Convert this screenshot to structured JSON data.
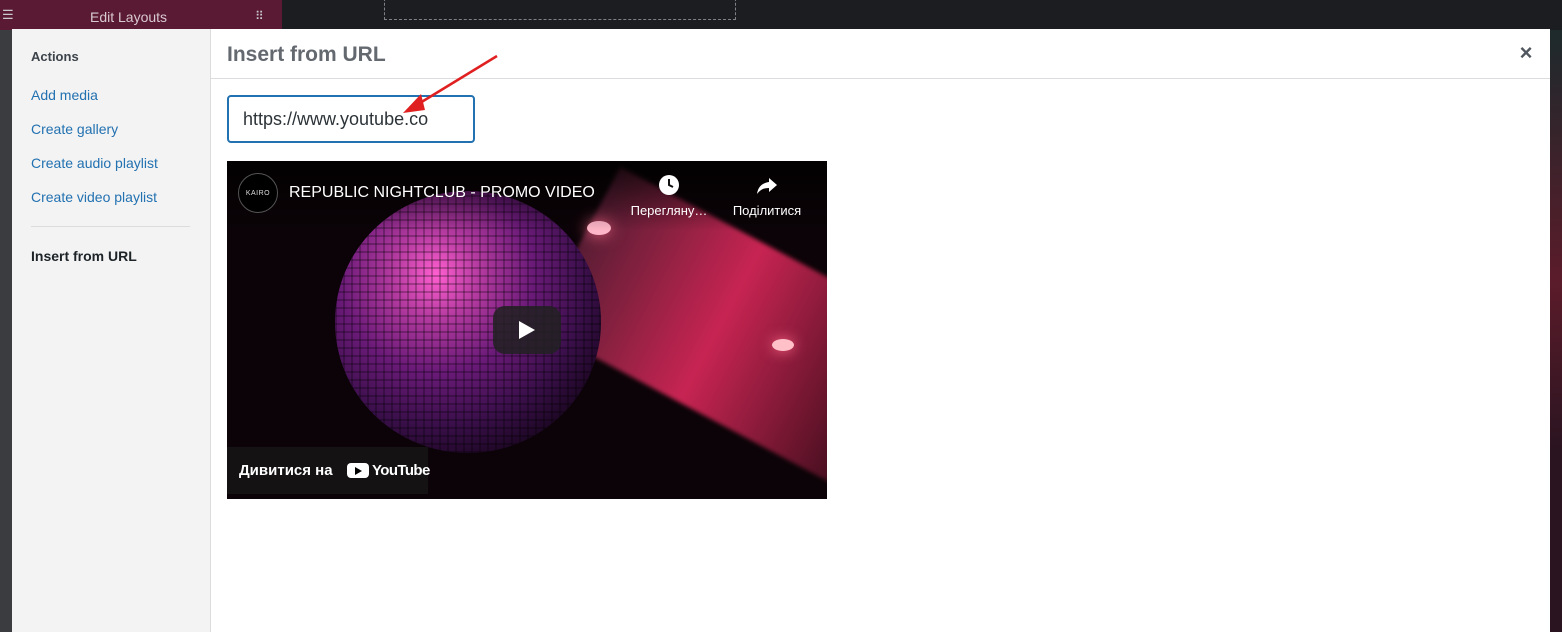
{
  "background": {
    "title": "Edit Layouts"
  },
  "menu": {
    "heading": "Actions",
    "items": [
      {
        "label": "Add media"
      },
      {
        "label": "Create gallery"
      },
      {
        "label": "Create audio playlist"
      },
      {
        "label": "Create video playlist"
      }
    ],
    "active_item": "Insert from URL"
  },
  "frame": {
    "title": "Insert from URL",
    "close_label": "×"
  },
  "url_input": {
    "value": "https://www.youtube.co"
  },
  "video": {
    "channel_logo_text": "KAIRO",
    "title": "REPUBLIC NIGHTCLUB - PROMO VIDEO",
    "watch_later_label": "Перегляну…",
    "share_label": "Поділитися",
    "watch_on_label": "Дивитися на",
    "brand_label": "YouTube"
  },
  "colors": {
    "accent": "#2271b1",
    "annotation_arrow": "#e02020",
    "youtube_bar": "#171717"
  },
  "icons": {
    "close": "close-icon",
    "watch_later": "clock-icon",
    "share": "share-icon",
    "play": "play-icon",
    "menu": "hamburger-icon",
    "grid": "grid-icon"
  }
}
